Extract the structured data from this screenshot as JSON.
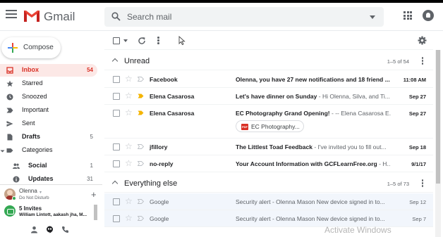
{
  "header": {
    "app_name": "Gmail",
    "search_placeholder": "Search mail"
  },
  "compose_label": "Compose",
  "sidebar": {
    "items": [
      {
        "label": "Inbox",
        "count": "54"
      },
      {
        "label": "Starred",
        "count": ""
      },
      {
        "label": "Snoozed",
        "count": ""
      },
      {
        "label": "Important",
        "count": ""
      },
      {
        "label": "Sent",
        "count": ""
      },
      {
        "label": "Drafts",
        "count": "5"
      },
      {
        "label": "Categories",
        "count": ""
      },
      {
        "label": "Social",
        "count": "1"
      },
      {
        "label": "Updates",
        "count": "31"
      }
    ]
  },
  "hangouts": {
    "user_name": "Olenna",
    "user_caret": "▾",
    "user_status": "Do Not Disturb",
    "add_label": "+",
    "invites_title": "5 Invites",
    "invites_sub": "William Lintott, aakash jha, M..."
  },
  "sections": {
    "unread": {
      "title": "Unread",
      "count": "1–5 of 54"
    },
    "everything_else": {
      "title": "Everything else",
      "count": "1–5 of 73"
    }
  },
  "unread_rows": [
    {
      "sender": "Facebook",
      "subject": "Olenna, you have 27 new notifications and 18 friend ...",
      "snippet": "",
      "date": "11:08 AM",
      "important": false
    },
    {
      "sender": "Elena Casarosa",
      "subject": "Let's have dinner on Sunday",
      "snippet": " - Hi Olenna, Silva, and Ti...",
      "date": "Sep 27",
      "important": true
    },
    {
      "sender": "Elena Casarosa",
      "subject": "EC Photography Grand Opening!",
      "snippet": " - -- Elena Casarosa E...",
      "date": "Sep 27",
      "important": true,
      "attachment": "EC Photography..."
    },
    {
      "sender": "jfillory",
      "subject": "The Littlest Toad Feedback",
      "snippet": " - I've invited you to fill out...",
      "date": "Sep 18",
      "important": false
    },
    {
      "sender": "no-reply",
      "subject": "Your Account Information with GCFLearnFree.org",
      "snippet": " - H...",
      "date": "9/1/17",
      "important": false
    }
  ],
  "other_rows": [
    {
      "sender": "Google",
      "subject": "Security alert",
      "snippet": " - Olenna Mason New device signed in to...",
      "date": "Sep 12"
    },
    {
      "sender": "Google",
      "subject": "Security alert",
      "snippet": " - Olenna Mason New device signed in to...",
      "date": "Sep 7"
    }
  ],
  "watermark": "Activate Windows",
  "colors": {
    "accent_red": "#d93025",
    "important_yellow": "#f4b400",
    "read_row_bg": "#f2f6fc"
  }
}
